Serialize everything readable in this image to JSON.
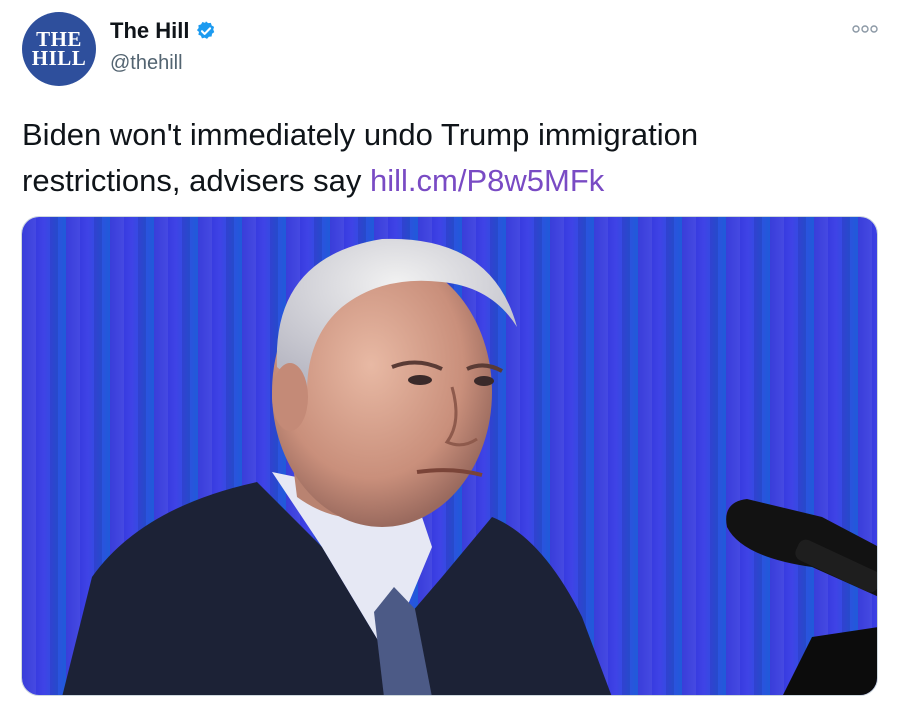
{
  "account": {
    "avatar_line1": "THE",
    "avatar_line2": "HILL",
    "display_name": "The Hill",
    "handle": "@thehill",
    "verified": true
  },
  "tweet": {
    "text": "Biden won't immediately undo Trump immigration restrictions, advisers say ",
    "link": "hill.cm/P8w5MFk"
  },
  "icons": {
    "verified": "verified-badge-icon",
    "more": "more-options-icon"
  },
  "colors": {
    "link": "#794bc4",
    "avatar_bg": "#2e4f9c",
    "verified": "#1d9bf0",
    "photo_backdrop": "#3b3fe0"
  }
}
